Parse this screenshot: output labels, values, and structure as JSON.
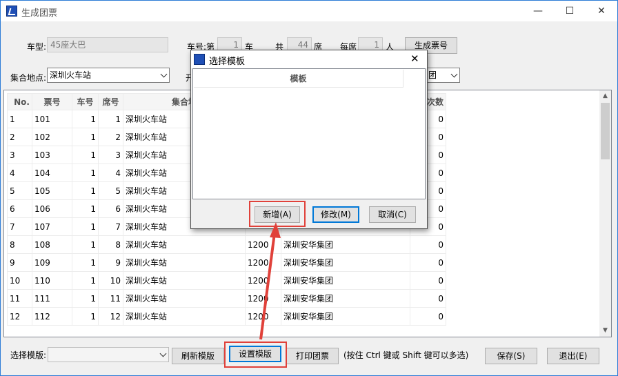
{
  "window": {
    "title": "生成团票",
    "minimize": "—",
    "maximize": "☐",
    "close": "✕"
  },
  "form": {
    "bus_type_label": "车型:",
    "bus_type_value": "45座大巴",
    "car_no_label": "车号:第",
    "car_no_value": "1",
    "car_unit": "车",
    "total_label": "共",
    "total_value": "44",
    "total_unit": "席",
    "per_seat_label": "每席",
    "per_seat_value": "1",
    "per_seat_unit": "人",
    "generate_button": "生成票号",
    "meeting_point_label": "集合地点:",
    "meeting_point_value": "深圳火车站",
    "start_label": "开",
    "right_select_value": "团"
  },
  "table": {
    "headers": [
      "No.",
      "票号",
      "车号",
      "席号",
      "集合地",
      "",
      "",
      "次数"
    ],
    "rows": [
      [
        "1",
        "101",
        "1",
        "1",
        "深圳火车站",
        "",
        "",
        "0"
      ],
      [
        "2",
        "102",
        "1",
        "2",
        "深圳火车站",
        "",
        "",
        "0"
      ],
      [
        "3",
        "103",
        "1",
        "3",
        "深圳火车站",
        "",
        "",
        "0"
      ],
      [
        "4",
        "104",
        "1",
        "4",
        "深圳火车站",
        "",
        "",
        "0"
      ],
      [
        "5",
        "105",
        "1",
        "5",
        "深圳火车站",
        "",
        "",
        "0"
      ],
      [
        "6",
        "106",
        "1",
        "6",
        "深圳火车站",
        "",
        "",
        "0"
      ],
      [
        "7",
        "107",
        "1",
        "7",
        "深圳火车站",
        "",
        "",
        "0"
      ],
      [
        "8",
        "108",
        "1",
        "8",
        "深圳火车站",
        "1200",
        "深圳安华集团",
        "0"
      ],
      [
        "9",
        "109",
        "1",
        "9",
        "深圳火车站",
        "1200",
        "深圳安华集团",
        "0"
      ],
      [
        "10",
        "110",
        "1",
        "10",
        "深圳火车站",
        "1200",
        "深圳安华集团",
        "0"
      ],
      [
        "11",
        "111",
        "1",
        "11",
        "深圳火车站",
        "1200",
        "深圳安华集团",
        "0"
      ],
      [
        "12",
        "112",
        "1",
        "12",
        "深圳火车站",
        "1200",
        "深圳安华集团",
        "0"
      ]
    ]
  },
  "bottom": {
    "template_label": "选择模版:",
    "template_value": "",
    "refresh_button": "刷新模版",
    "setup_button": "设置模版",
    "print_button": "打印团票",
    "hint": "(按住 Ctrl 键或 Shift 键可以多选)",
    "save_button": "保存(S)",
    "exit_button": "退出(E)"
  },
  "dialog": {
    "title": "选择模板",
    "close": "✕",
    "column_header": "模板",
    "add_button": "新增(A)",
    "edit_button": "修改(M)",
    "cancel_button": "取消(C)"
  },
  "colors": {
    "highlight": "#e0413a",
    "accent": "#0078d7"
  }
}
